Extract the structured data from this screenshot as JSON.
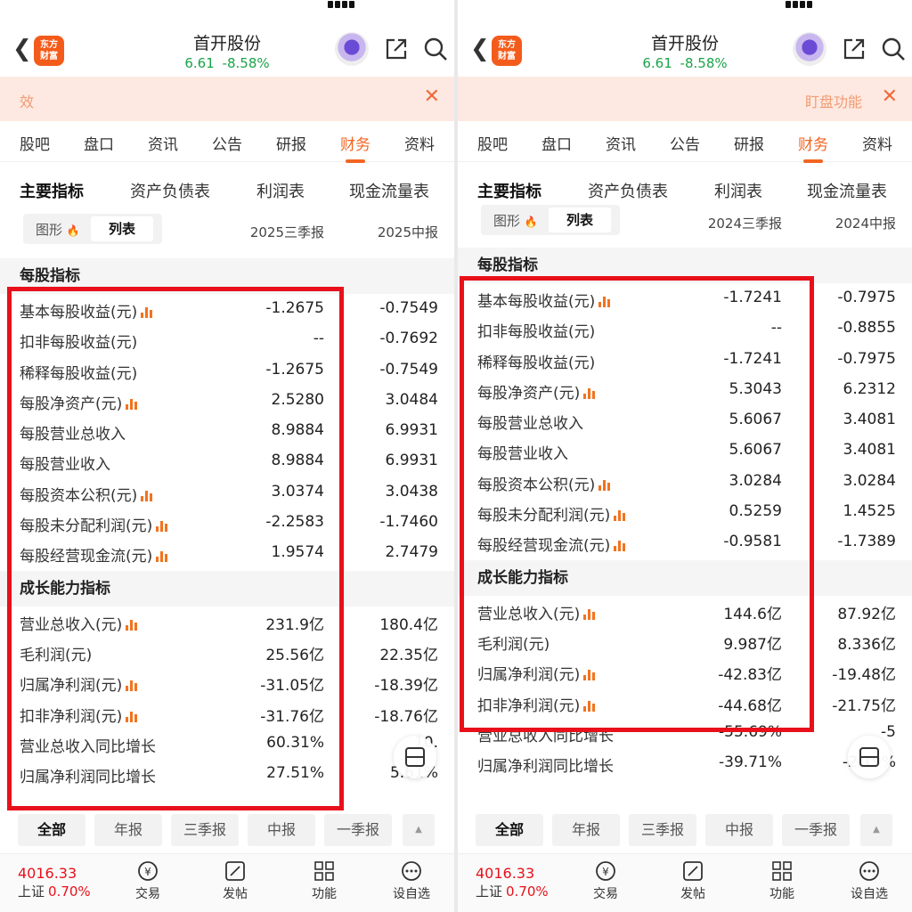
{
  "common": {
    "stock_name": "首开股份",
    "price": "6.61",
    "change": "-8.58%",
    "logo_text_1": "东方",
    "logo_text_2": "财富",
    "tabs": [
      "股吧",
      "盘口",
      "资讯",
      "公告",
      "研报",
      "财务",
      "资料"
    ],
    "active_tab": "财务",
    "subtabs": [
      "主要指标",
      "资产负债表",
      "利润表",
      "现金流量表"
    ],
    "view_chart": "图形",
    "view_list": "列表",
    "periods": [
      "全部",
      "年报",
      "三季报",
      "中报",
      "一季报"
    ],
    "index_value": "4016.33",
    "index_name": "上证",
    "index_pct": "0.70%",
    "nav": [
      "交易",
      "发帖",
      "功能",
      "设自选"
    ],
    "colors": {
      "accent": "#f26522",
      "down": "#1aa34a",
      "up": "#e8101a",
      "highlight_box": "#e8101a"
    }
  },
  "left": {
    "banner_text": "效",
    "col1": "2025三季报",
    "col2": "2025中报",
    "sec1_title": "每股指标",
    "sec1_rows": [
      {
        "label": "基本每股收益(元)",
        "chart": true,
        "v1": "-1.2675",
        "v2": "-0.7549"
      },
      {
        "label": "扣非每股收益(元)",
        "chart": false,
        "v1": "--",
        "v2": "-0.7692"
      },
      {
        "label": "稀释每股收益(元)",
        "chart": false,
        "v1": "-1.2675",
        "v2": "-0.7549"
      },
      {
        "label": "每股净资产(元)",
        "chart": true,
        "v1": "2.5280",
        "v2": "3.0484"
      },
      {
        "label": "每股营业总收入",
        "chart": false,
        "v1": "8.9884",
        "v2": "6.9931"
      },
      {
        "label": "每股营业收入",
        "chart": false,
        "v1": "8.9884",
        "v2": "6.9931"
      },
      {
        "label": "每股资本公积(元)",
        "chart": true,
        "v1": "3.0374",
        "v2": "3.0438"
      },
      {
        "label": "每股未分配利润(元)",
        "chart": true,
        "v1": "-2.2583",
        "v2": "-1.7460"
      },
      {
        "label": "每股经营现金流(元)",
        "chart": true,
        "v1": "1.9574",
        "v2": "2.7479"
      }
    ],
    "sec2_title": "成长能力指标",
    "sec2_rows": [
      {
        "label": "营业总收入(元)",
        "chart": true,
        "v1": "231.9亿",
        "v2": "180.4亿"
      },
      {
        "label": "毛利润(元)",
        "chart": false,
        "v1": "25.56亿",
        "v2": "22.35亿"
      },
      {
        "label": "归属净利润(元)",
        "chart": true,
        "v1": "-31.05亿",
        "v2": "-18.39亿"
      },
      {
        "label": "扣非净利润(元)",
        "chart": true,
        "v1": "-31.76亿",
        "v2": "-18.76亿"
      },
      {
        "label": "营业总收入同比增长",
        "chart": false,
        "v1": "60.31%",
        "v2": "10."
      },
      {
        "label": "归属净利润同比增长",
        "chart": false,
        "v1": "27.51%",
        "v2": "5.61%"
      }
    ]
  },
  "right": {
    "banner_text": "盯盘功能",
    "col1": "2024三季报",
    "col2": "2024中报",
    "sec1_title": "每股指标",
    "sec1_rows": [
      {
        "label": "基本每股收益(元)",
        "chart": true,
        "v1": "-1.7241",
        "v2": "-0.7975"
      },
      {
        "label": "扣非每股收益(元)",
        "chart": false,
        "v1": "--",
        "v2": "-0.8855"
      },
      {
        "label": "稀释每股收益(元)",
        "chart": false,
        "v1": "-1.7241",
        "v2": "-0.7975"
      },
      {
        "label": "每股净资产(元)",
        "chart": true,
        "v1": "5.3043",
        "v2": "6.2312"
      },
      {
        "label": "每股营业总收入",
        "chart": false,
        "v1": "5.6067",
        "v2": "3.4081"
      },
      {
        "label": "每股营业收入",
        "chart": false,
        "v1": "5.6067",
        "v2": "3.4081"
      },
      {
        "label": "每股资本公积(元)",
        "chart": true,
        "v1": "3.0284",
        "v2": "3.0284"
      },
      {
        "label": "每股未分配利润(元)",
        "chart": true,
        "v1": "0.5259",
        "v2": "1.4525"
      },
      {
        "label": "每股经营现金流(元)",
        "chart": true,
        "v1": "-0.9581",
        "v2": "-1.7389"
      }
    ],
    "sec2_title": "成长能力指标",
    "sec2_rows": [
      {
        "label": "营业总收入(元)",
        "chart": true,
        "v1": "144.6亿",
        "v2": "87.92亿"
      },
      {
        "label": "毛利润(元)",
        "chart": false,
        "v1": "9.987亿",
        "v2": "8.336亿"
      },
      {
        "label": "归属净利润(元)",
        "chart": true,
        "v1": "-42.83亿",
        "v2": "-19.48亿"
      },
      {
        "label": "扣非净利润(元)",
        "chart": true,
        "v1": "-44.68亿",
        "v2": "-21.75亿"
      },
      {
        "label": "营业总收入同比增长",
        "chart": false,
        "v1": "-55.69%",
        "v2": "-5"
      },
      {
        "label": "归属净利润同比增长",
        "chart": false,
        "v1": "-39.71%",
        "v2": "-2.19%"
      }
    ]
  }
}
